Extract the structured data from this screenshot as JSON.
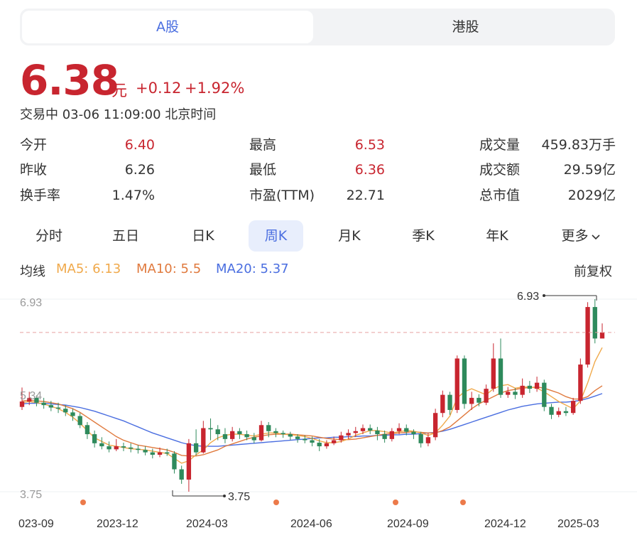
{
  "market_tabs": [
    {
      "label": "A股",
      "active": true
    },
    {
      "label": "港股",
      "active": false
    }
  ],
  "quote": {
    "price": "6.38",
    "unit": "元",
    "change": "+0.12",
    "change_pct": "+1.92%",
    "status": "交易中 03-06 11:09:00 北京时间"
  },
  "stats": {
    "open": {
      "label": "今开",
      "value": "6.40"
    },
    "prev_close": {
      "label": "昨收",
      "value": "6.26"
    },
    "turnover_rate": {
      "label": "换手率",
      "value": "1.47%"
    },
    "high": {
      "label": "最高",
      "value": "6.53"
    },
    "low": {
      "label": "最低",
      "value": "6.36"
    },
    "pe": {
      "label": "市盈(TTM)",
      "value": "22.71"
    },
    "volume": {
      "label": "成交量",
      "value": "459.83万手"
    },
    "amount": {
      "label": "成交额",
      "value": "29.59亿"
    },
    "market_cap": {
      "label": "总市值",
      "value": "2029亿"
    }
  },
  "period_tabs": [
    {
      "label": "分时",
      "active": false
    },
    {
      "label": "五日",
      "active": false
    },
    {
      "label": "日K",
      "active": false
    },
    {
      "label": "周K",
      "active": true
    },
    {
      "label": "月K",
      "active": false
    },
    {
      "label": "季K",
      "active": false
    },
    {
      "label": "年K",
      "active": false
    },
    {
      "label": "更多",
      "active": false
    }
  ],
  "ma_legend": {
    "title": "均线",
    "ma5": "MA5: 6.13",
    "ma10": "MA10: 5.5",
    "ma20": "MA20: 5.37",
    "adjust": "前复权"
  },
  "colors": {
    "up": "#c8252f",
    "down": "#2e8a5c",
    "ma5": "#f0a94b",
    "ma10": "#e07a3e",
    "ma20": "#4a6ee0",
    "accent": "#4a6ee0"
  },
  "chart_data": {
    "type": "candlestick",
    "y_ticks": [
      "6.93",
      "5.34",
      "3.75"
    ],
    "ylim": [
      3.75,
      6.93
    ],
    "x_ticks": [
      "023-09",
      "2023-12",
      "2024-03",
      "2024-06",
      "2024-09",
      "2024-12",
      "2025-03"
    ],
    "max_label": "6.93",
    "min_label": "3.75",
    "current_price_line": 6.38,
    "candles": [
      [
        5.15,
        5.24,
        5.47,
        5.1
      ],
      [
        5.24,
        5.3,
        5.4,
        5.18
      ],
      [
        5.3,
        5.22,
        5.34,
        5.16
      ],
      [
        5.22,
        5.18,
        5.3,
        5.12
      ],
      [
        5.18,
        5.14,
        5.25,
        5.08
      ],
      [
        5.14,
        5.12,
        5.22,
        5.05
      ],
      [
        5.12,
        5.06,
        5.18,
        5.0
      ],
      [
        5.06,
        5.0,
        5.12,
        4.92
      ],
      [
        5.0,
        4.85,
        5.05,
        4.8
      ],
      [
        4.85,
        4.7,
        4.9,
        4.62
      ],
      [
        4.7,
        4.55,
        4.76,
        4.48
      ],
      [
        4.55,
        4.5,
        4.65,
        4.45
      ],
      [
        4.5,
        4.45,
        4.58,
        4.4
      ],
      [
        4.45,
        4.5,
        4.62,
        4.42
      ],
      [
        4.5,
        4.48,
        4.56,
        4.42
      ],
      [
        4.48,
        4.46,
        4.55,
        4.4
      ],
      [
        4.46,
        4.44,
        4.52,
        4.38
      ],
      [
        4.44,
        4.4,
        4.5,
        4.35
      ],
      [
        4.4,
        4.36,
        4.46,
        4.3
      ],
      [
        4.36,
        4.4,
        4.48,
        4.32
      ],
      [
        4.4,
        4.38,
        4.46,
        4.34
      ],
      [
        4.38,
        4.12,
        4.42,
        4.05
      ],
      [
        4.12,
        3.95,
        4.18,
        3.88
      ],
      [
        3.95,
        4.55,
        4.62,
        3.75
      ],
      [
        4.55,
        4.4,
        4.78,
        4.35
      ],
      [
        4.4,
        4.8,
        4.92,
        4.38
      ],
      [
        4.8,
        4.78,
        4.96,
        4.6
      ],
      [
        4.78,
        4.7,
        4.85,
        4.6
      ],
      [
        4.7,
        4.62,
        4.8,
        4.55
      ],
      [
        4.62,
        4.75,
        4.82,
        4.58
      ],
      [
        4.75,
        4.7,
        4.8,
        4.62
      ],
      [
        4.7,
        4.65,
        4.76,
        4.6
      ],
      [
        4.65,
        4.6,
        4.72,
        4.55
      ],
      [
        4.6,
        4.85,
        4.92,
        4.58
      ],
      [
        4.85,
        4.75,
        4.9,
        4.65
      ],
      [
        4.75,
        4.72,
        4.8,
        4.65
      ],
      [
        4.72,
        4.7,
        4.76,
        4.64
      ],
      [
        4.7,
        4.66,
        4.74,
        4.6
      ],
      [
        4.66,
        4.62,
        4.7,
        4.56
      ],
      [
        4.62,
        4.6,
        4.68,
        4.55
      ],
      [
        4.6,
        4.56,
        4.66,
        4.5
      ],
      [
        4.56,
        4.5,
        4.62,
        4.42
      ],
      [
        4.5,
        4.55,
        4.6,
        4.46
      ],
      [
        4.55,
        4.6,
        4.66,
        4.52
      ],
      [
        4.6,
        4.68,
        4.74,
        4.56
      ],
      [
        4.68,
        4.72,
        4.78,
        4.62
      ],
      [
        4.72,
        4.75,
        4.82,
        4.66
      ],
      [
        4.75,
        4.8,
        4.86,
        4.7
      ],
      [
        4.8,
        4.76,
        4.86,
        4.7
      ],
      [
        4.76,
        4.7,
        4.82,
        4.6
      ],
      [
        4.7,
        4.62,
        4.76,
        4.56
      ],
      [
        4.62,
        4.75,
        4.8,
        4.58
      ],
      [
        4.75,
        4.8,
        4.88,
        4.7
      ],
      [
        4.8,
        4.74,
        4.86,
        4.68
      ],
      [
        4.74,
        4.7,
        4.78,
        4.62
      ],
      [
        4.7,
        4.55,
        4.74,
        4.48
      ],
      [
        4.55,
        4.65,
        4.72,
        4.5
      ],
      [
        4.65,
        5.05,
        5.12,
        4.6
      ],
      [
        5.05,
        5.35,
        5.42,
        4.98
      ],
      [
        5.35,
        5.1,
        5.4,
        5.02
      ],
      [
        5.1,
        5.95,
        6.0,
        5.05
      ],
      [
        5.95,
        5.2,
        6.0,
        5.12
      ],
      [
        5.2,
        5.3,
        5.4,
        5.1
      ],
      [
        5.3,
        5.22,
        5.36,
        5.16
      ],
      [
        5.22,
        5.45,
        5.52,
        5.18
      ],
      [
        5.45,
        5.95,
        6.2,
        5.4
      ],
      [
        5.95,
        5.35,
        6.28,
        5.3
      ],
      [
        5.35,
        5.4,
        5.48,
        5.3
      ],
      [
        5.4,
        5.35,
        5.46,
        5.28
      ],
      [
        5.35,
        5.5,
        5.62,
        5.3
      ],
      [
        5.5,
        5.45,
        5.58,
        5.38
      ],
      [
        5.45,
        5.55,
        5.65,
        5.4
      ],
      [
        5.55,
        5.15,
        5.6,
        5.08
      ],
      [
        5.15,
        5.02,
        5.2,
        4.95
      ],
      [
        5.02,
        5.08,
        5.14,
        4.98
      ],
      [
        5.08,
        5.05,
        5.15,
        5.0
      ],
      [
        5.05,
        5.25,
        5.3,
        5.02
      ],
      [
        5.25,
        5.85,
        5.95,
        5.2
      ],
      [
        5.85,
        6.8,
        6.88,
        5.8
      ],
      [
        6.8,
        6.28,
        6.93,
        6.2
      ],
      [
        6.28,
        6.38,
        6.53,
        6.36
      ]
    ],
    "ma5": [
      5.22,
      5.24,
      5.22,
      5.2,
      5.16,
      5.12,
      5.06,
      4.98,
      4.88,
      4.76,
      4.64,
      4.58,
      4.52,
      4.5,
      4.48,
      4.46,
      4.45,
      4.44,
      4.42,
      4.4,
      4.38,
      4.3,
      4.22,
      4.26,
      4.36,
      4.44,
      4.56,
      4.64,
      4.68,
      4.7,
      4.7,
      4.68,
      4.67,
      4.7,
      4.72,
      4.72,
      4.7,
      4.69,
      4.68,
      4.66,
      4.63,
      4.59,
      4.56,
      4.56,
      4.58,
      4.62,
      4.68,
      4.72,
      4.76,
      4.76,
      4.74,
      4.72,
      4.74,
      4.76,
      4.75,
      4.72,
      4.68,
      4.72,
      4.85,
      5.0,
      5.3,
      5.4,
      5.45,
      5.4,
      5.35,
      5.45,
      5.5,
      5.52,
      5.46,
      5.48,
      5.48,
      5.46,
      5.4,
      5.32,
      5.24,
      5.18,
      5.12,
      5.25,
      5.55,
      5.9,
      6.13
    ],
    "ma10": [
      5.25,
      5.26,
      5.25,
      5.24,
      5.22,
      5.2,
      5.16,
      5.12,
      5.06,
      4.98,
      4.9,
      4.82,
      4.74,
      4.66,
      4.6,
      4.56,
      4.52,
      4.5,
      4.48,
      4.46,
      4.44,
      4.4,
      4.35,
      4.34,
      4.34,
      4.36,
      4.4,
      4.44,
      4.5,
      4.54,
      4.58,
      4.62,
      4.65,
      4.67,
      4.69,
      4.7,
      4.7,
      4.7,
      4.69,
      4.68,
      4.67,
      4.65,
      4.63,
      4.62,
      4.61,
      4.61,
      4.62,
      4.64,
      4.66,
      4.68,
      4.7,
      4.71,
      4.72,
      4.73,
      4.74,
      4.73,
      4.72,
      4.72,
      4.76,
      4.82,
      4.92,
      5.02,
      5.12,
      5.2,
      5.26,
      5.32,
      5.38,
      5.42,
      5.44,
      5.46,
      5.47,
      5.48,
      5.46,
      5.42,
      5.38,
      5.32,
      5.28,
      5.28,
      5.32,
      5.42,
      5.5
    ],
    "ma20": [
      5.2,
      5.21,
      5.21,
      5.21,
      5.2,
      5.19,
      5.18,
      5.16,
      5.14,
      5.11,
      5.08,
      5.04,
      5.0,
      4.96,
      4.92,
      4.87,
      4.82,
      4.77,
      4.72,
      4.68,
      4.64,
      4.6,
      4.56,
      4.53,
      4.51,
      4.5,
      4.5,
      4.5,
      4.51,
      4.52,
      4.53,
      4.54,
      4.55,
      4.56,
      4.57,
      4.58,
      4.59,
      4.6,
      4.61,
      4.62,
      4.63,
      4.64,
      4.64,
      4.65,
      4.65,
      4.66,
      4.66,
      4.67,
      4.67,
      4.68,
      4.68,
      4.69,
      4.69,
      4.7,
      4.7,
      4.71,
      4.72,
      4.73,
      4.75,
      4.78,
      4.82,
      4.86,
      4.9,
      4.94,
      4.98,
      5.02,
      5.06,
      5.1,
      5.13,
      5.16,
      5.18,
      5.2,
      5.21,
      5.22,
      5.23,
      5.23,
      5.24,
      5.26,
      5.29,
      5.33,
      5.37
    ]
  }
}
